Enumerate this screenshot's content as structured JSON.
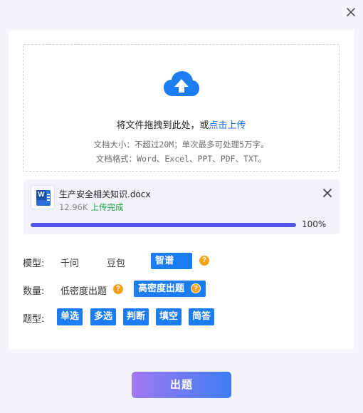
{
  "dropzone": {
    "prompt": "将文件拖拽到此处，或",
    "link": "点击上传",
    "hint_size": "文档大小：不超过20M；单次最多可处理5万字。",
    "hint_format": "文档格式：Word、Excel、PPT、PDF、TXT。"
  },
  "file": {
    "icon_letter": "W",
    "name": "生产安全相关知识.docx",
    "size": "12.96K",
    "status": "上传完成",
    "progress_value": 1.0,
    "progress_text": "100%"
  },
  "model": {
    "label": "模型:",
    "options": [
      "千问",
      "豆包",
      "智谱"
    ],
    "selected": "智谱"
  },
  "quantity": {
    "label": "数量:",
    "options": [
      "低密度出题",
      "高密度出题"
    ],
    "selected": "高密度出题"
  },
  "question_type": {
    "label": "题型:",
    "options": [
      "单选",
      "多选",
      "判断",
      "填空",
      "简答"
    ]
  },
  "help_glyph": "?",
  "submit_label": "出题",
  "colors": {
    "accent": "#1c7cf2",
    "link": "#1e6fe0",
    "success": "#1d9e3c",
    "progress": "#5158e6",
    "help": "#f5a21a",
    "button_gradient_start": "#a278f1",
    "button_gradient_end": "#3f7df4"
  },
  "icons": [
    "close-icon",
    "cloud-upload-icon",
    "word-file-icon",
    "remove-file-icon",
    "help-icon"
  ]
}
